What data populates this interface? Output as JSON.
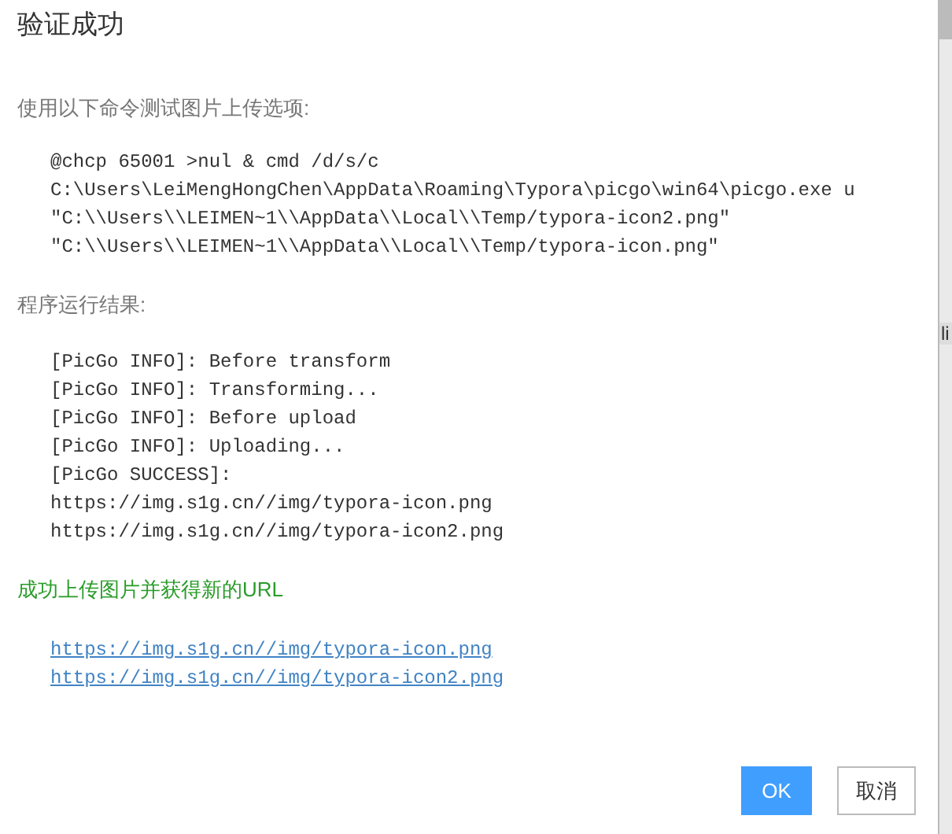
{
  "dialog": {
    "title": "验证成功",
    "intro": "使用以下命令测试图片上传选项:",
    "command_lines": [
      "@chcp 65001 >nul & cmd /d/s/c",
      "C:\\Users\\LeiMengHongChen\\AppData\\Roaming\\Typora\\picgo\\win64\\picgo.exe u",
      "\"C:\\\\Users\\\\LEIMEN~1\\\\AppData\\\\Local\\\\Temp/typora-icon2.png\"",
      "\"C:\\\\Users\\\\LEIMEN~1\\\\AppData\\\\Local\\\\Temp/typora-icon.png\""
    ],
    "result_label": "程序运行结果:",
    "log_lines": [
      "[PicGo INFO]: Before transform",
      "[PicGo INFO]: Transforming...",
      "[PicGo INFO]: Before upload",
      "[PicGo INFO]: Uploading...",
      "[PicGo SUCCESS]:",
      "https://img.s1g.cn//img/typora-icon.png",
      "https://img.s1g.cn//img/typora-icon2.png"
    ],
    "success_message": "成功上传图片并获得新的URL",
    "links": [
      "https://img.s1g.cn//img/typora-icon.png",
      "https://img.s1g.cn//img/typora-icon2.png"
    ],
    "buttons": [
      {
        "label": "OK",
        "kind": "primary"
      },
      {
        "label": "取消",
        "kind": "default"
      }
    ]
  },
  "background_text": "li"
}
